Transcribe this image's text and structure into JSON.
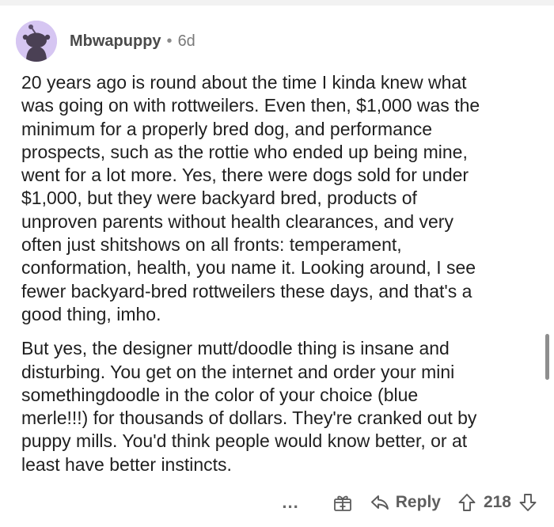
{
  "comment": {
    "username": "Mbwapuppy",
    "separator": "•",
    "age": "6d",
    "paragraphs": [
      "20 years ago is round about the time I kinda knew what\nwas going on with rottweilers. Even then, $1,000 was the\nminimum for a properly bred dog, and performance\nprospects, such as the rottie who ended up being mine,\nwent for a lot more. Yes, there were dogs sold for under\n$1,000, but they were backyard bred, products of\nunproven parents without health clearances, and very\noften just shitshows on all fronts: temperament,\nconformation, health, you name it. Looking around, I see\nfewer backyard-bred rottweilers these days, and that's a\ngood thing, imho.",
      "But yes, the designer mutt/doodle thing is insane and\ndisturbing. You get on the internet and order your mini\nsomethingdoodle in the color of your choice (blue\nmerle!!!) for thousands of dollars. They're cranked out by\npuppy mills. You'd think people would know better, or at\nleast have better instincts."
    ]
  },
  "actions": {
    "more_label": "...",
    "reply_label": "Reply",
    "vote_count": "218"
  },
  "icons": {
    "avatar": "reddit-snoo-avatar",
    "award": "gift-award-icon",
    "reply": "reply-arrow-icon",
    "upvote": "upvote-arrow-icon",
    "downvote": "downvote-arrow-icon"
  },
  "colors": {
    "avatar_bg": "#d6c6f2",
    "text": "#1f1f1f",
    "muted": "#5c5c5c"
  }
}
